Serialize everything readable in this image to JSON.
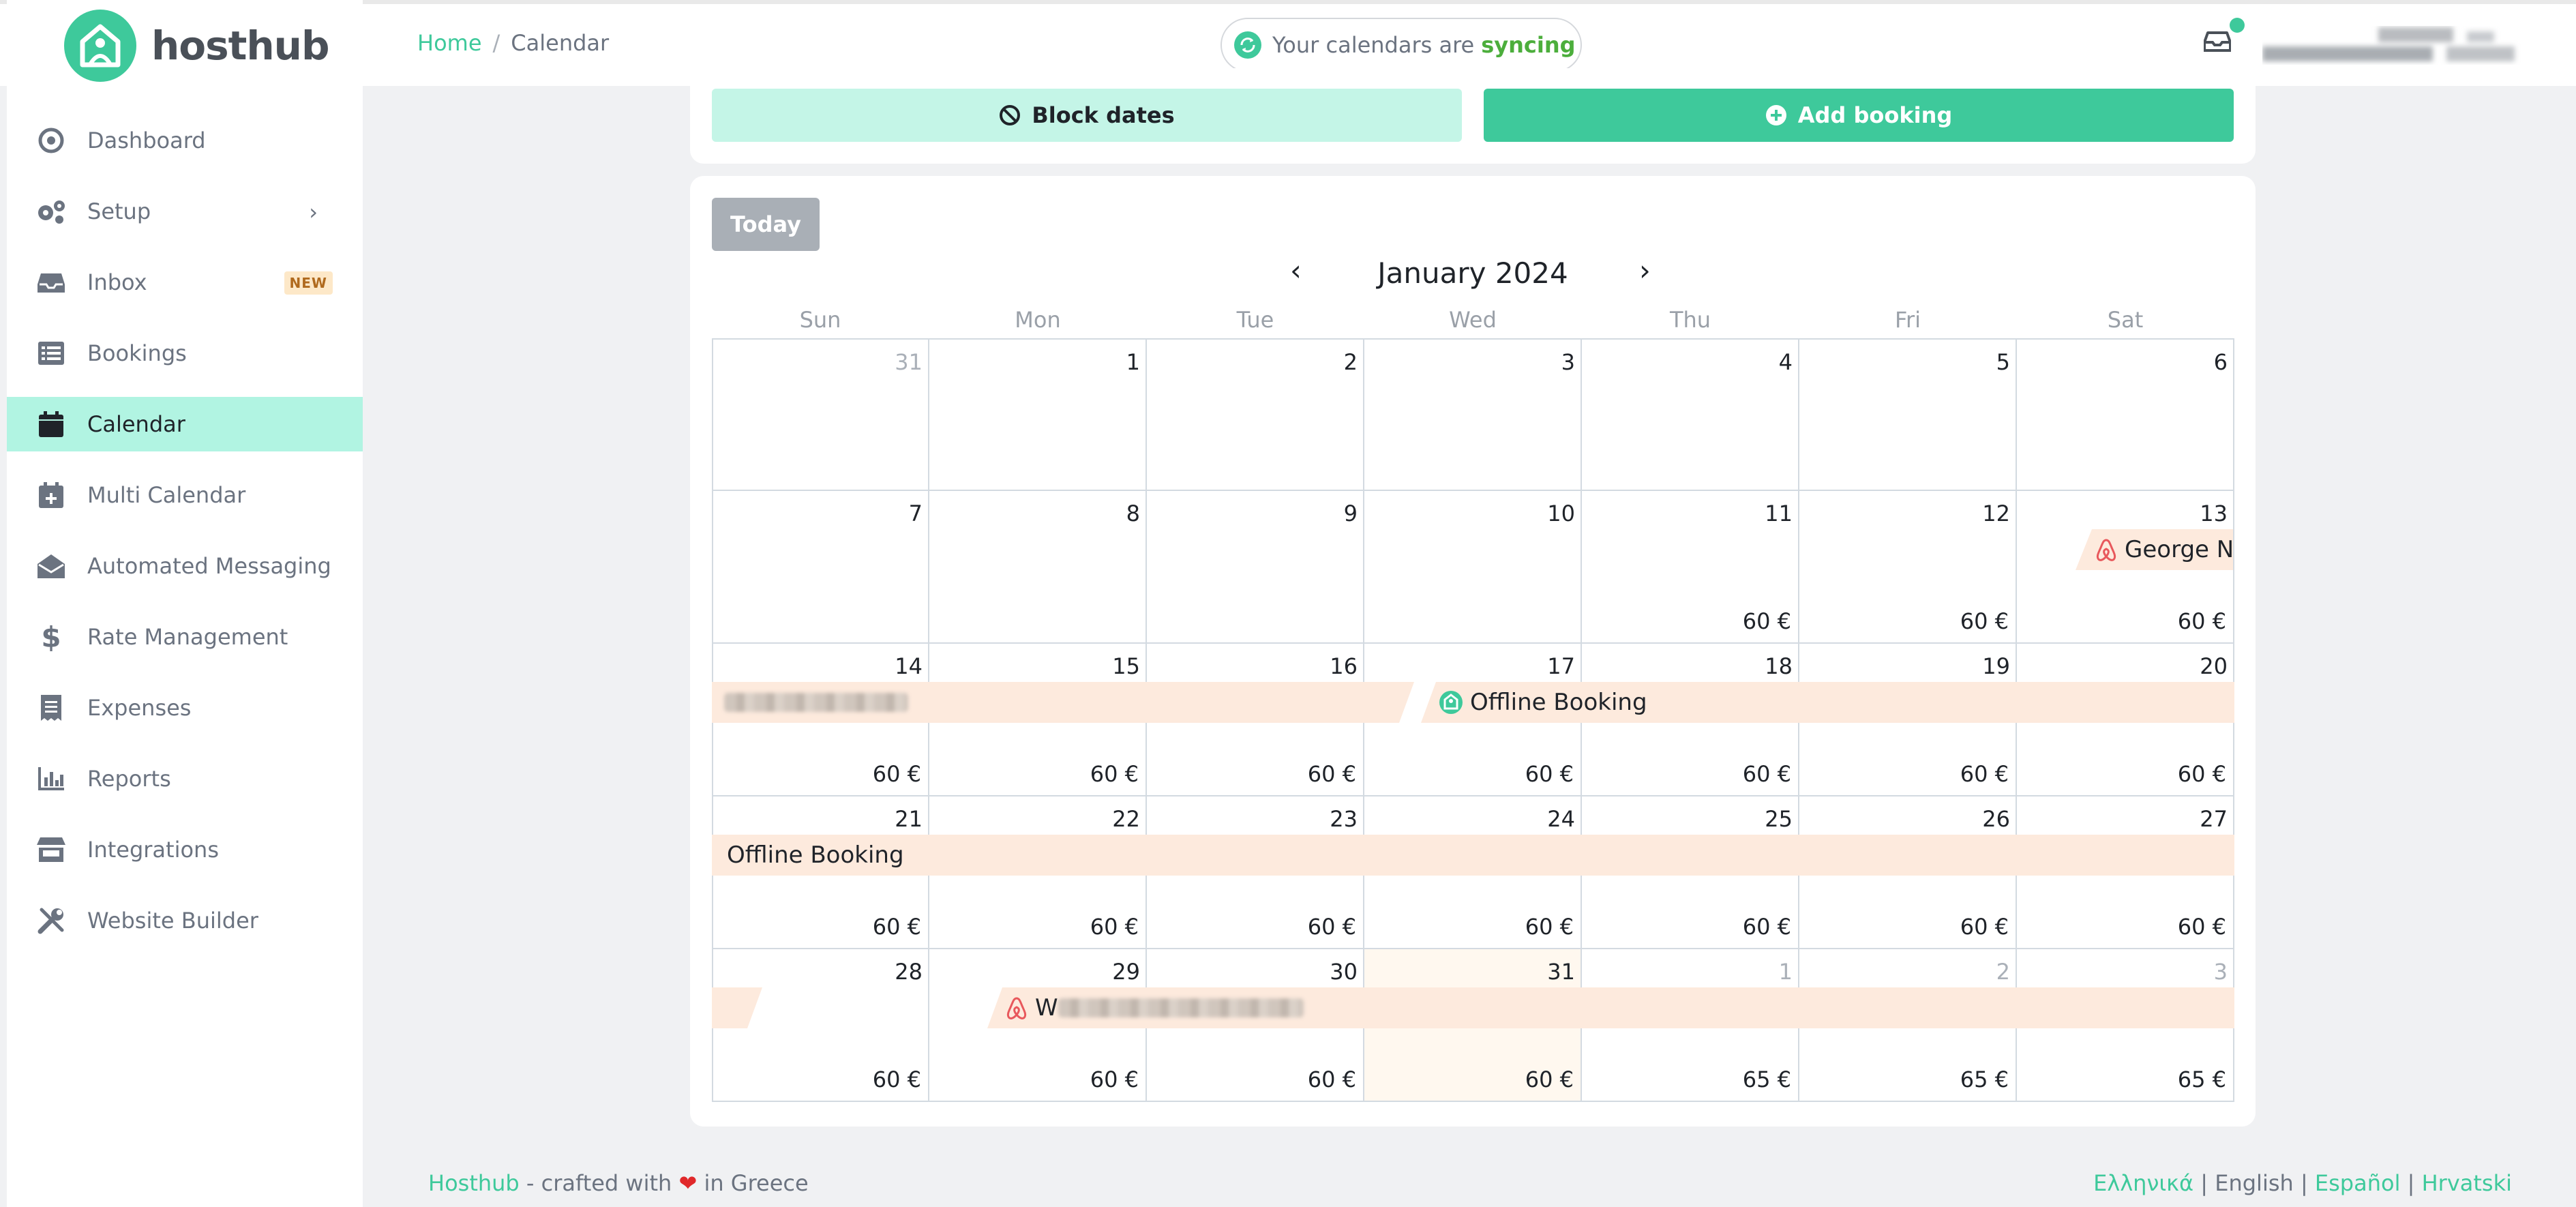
{
  "app": {
    "name": "hosthub"
  },
  "sidebar": {
    "items": [
      {
        "label": "Dashboard",
        "icon": "dashboard-icon"
      },
      {
        "label": "Setup",
        "icon": "gears-icon"
      },
      {
        "label": "Inbox",
        "icon": "inbox-icon",
        "badge": "NEW"
      },
      {
        "label": "Bookings",
        "icon": "list-icon"
      },
      {
        "label": "Calendar",
        "icon": "calendar-icon",
        "active": true
      },
      {
        "label": "Multi Calendar",
        "icon": "calendar-plus-icon"
      },
      {
        "label": "Automated Messaging",
        "icon": "envelope-open-icon"
      },
      {
        "label": "Rate Management",
        "icon": "dollar-icon"
      },
      {
        "label": "Expenses",
        "icon": "receipt-icon"
      },
      {
        "label": "Reports",
        "icon": "bar-chart-icon"
      },
      {
        "label": "Integrations",
        "icon": "store-icon"
      },
      {
        "label": "Website Builder",
        "icon": "tools-icon"
      }
    ]
  },
  "breadcrumb": {
    "home": "Home",
    "separator": "/",
    "current": "Calendar"
  },
  "sync": {
    "text": "Your calendars are",
    "status": "syncing"
  },
  "actions": {
    "block_label": "Block dates",
    "add_label": "Add booking"
  },
  "calendar": {
    "today_label": "Today",
    "month_title": "January 2024",
    "prev": "‹",
    "next": "›",
    "weekdays": [
      "Sun",
      "Mon",
      "Tue",
      "Wed",
      "Thu",
      "Fri",
      "Sat"
    ],
    "weeks": [
      [
        {
          "d": "31",
          "muted": true,
          "p": ""
        },
        {
          "d": "1",
          "p": ""
        },
        {
          "d": "2",
          "p": ""
        },
        {
          "d": "3",
          "p": ""
        },
        {
          "d": "4",
          "p": ""
        },
        {
          "d": "5",
          "p": ""
        },
        {
          "d": "6",
          "p": ""
        }
      ],
      [
        {
          "d": "7",
          "p": ""
        },
        {
          "d": "8",
          "p": ""
        },
        {
          "d": "9",
          "p": ""
        },
        {
          "d": "10",
          "p": ""
        },
        {
          "d": "11",
          "p": "60 €"
        },
        {
          "d": "12",
          "p": "60 €"
        },
        {
          "d": "13",
          "p": "60 €"
        }
      ],
      [
        {
          "d": "14",
          "p": "60 €"
        },
        {
          "d": "15",
          "p": "60 €"
        },
        {
          "d": "16",
          "p": "60 €"
        },
        {
          "d": "17",
          "p": "60 €"
        },
        {
          "d": "18",
          "p": "60 €"
        },
        {
          "d": "19",
          "p": "60 €"
        },
        {
          "d": "20",
          "p": "60 €"
        }
      ],
      [
        {
          "d": "21",
          "p": "60 €"
        },
        {
          "d": "22",
          "p": "60 €"
        },
        {
          "d": "23",
          "p": "60 €"
        },
        {
          "d": "24",
          "p": "60 €"
        },
        {
          "d": "25",
          "p": "60 €"
        },
        {
          "d": "26",
          "p": "60 €"
        },
        {
          "d": "27",
          "p": "60 €"
        }
      ],
      [
        {
          "d": "28",
          "p": "60 €"
        },
        {
          "d": "29",
          "p": "60 €"
        },
        {
          "d": "30",
          "p": "60 €"
        },
        {
          "d": "31",
          "p": "60 €",
          "today": true
        },
        {
          "d": "1",
          "muted": true,
          "p": "65 €"
        },
        {
          "d": "2",
          "muted": true,
          "p": "65 €"
        },
        {
          "d": "3",
          "muted": true,
          "p": "65 €"
        }
      ]
    ],
    "bookings": {
      "george": {
        "label": "George Ne",
        "source": "airbnb"
      },
      "offline1": {
        "label": "Offline Booking",
        "source": "hosthub"
      },
      "offline2": {
        "label": "Offline Booking"
      },
      "w_booking": {
        "label": "W",
        "source": "airbnb"
      }
    }
  },
  "footer": {
    "brand": "Hosthub",
    "crafted": " - crafted with ",
    "in_country": " in Greece",
    "languages": [
      "Ελληνικά",
      "English",
      "Español",
      "Hrvatski"
    ],
    "sep": " | "
  },
  "colors": {
    "accent": "#3ec99b",
    "booking_bg": "#fdeadd",
    "active_nav": "#b1f4e2"
  }
}
